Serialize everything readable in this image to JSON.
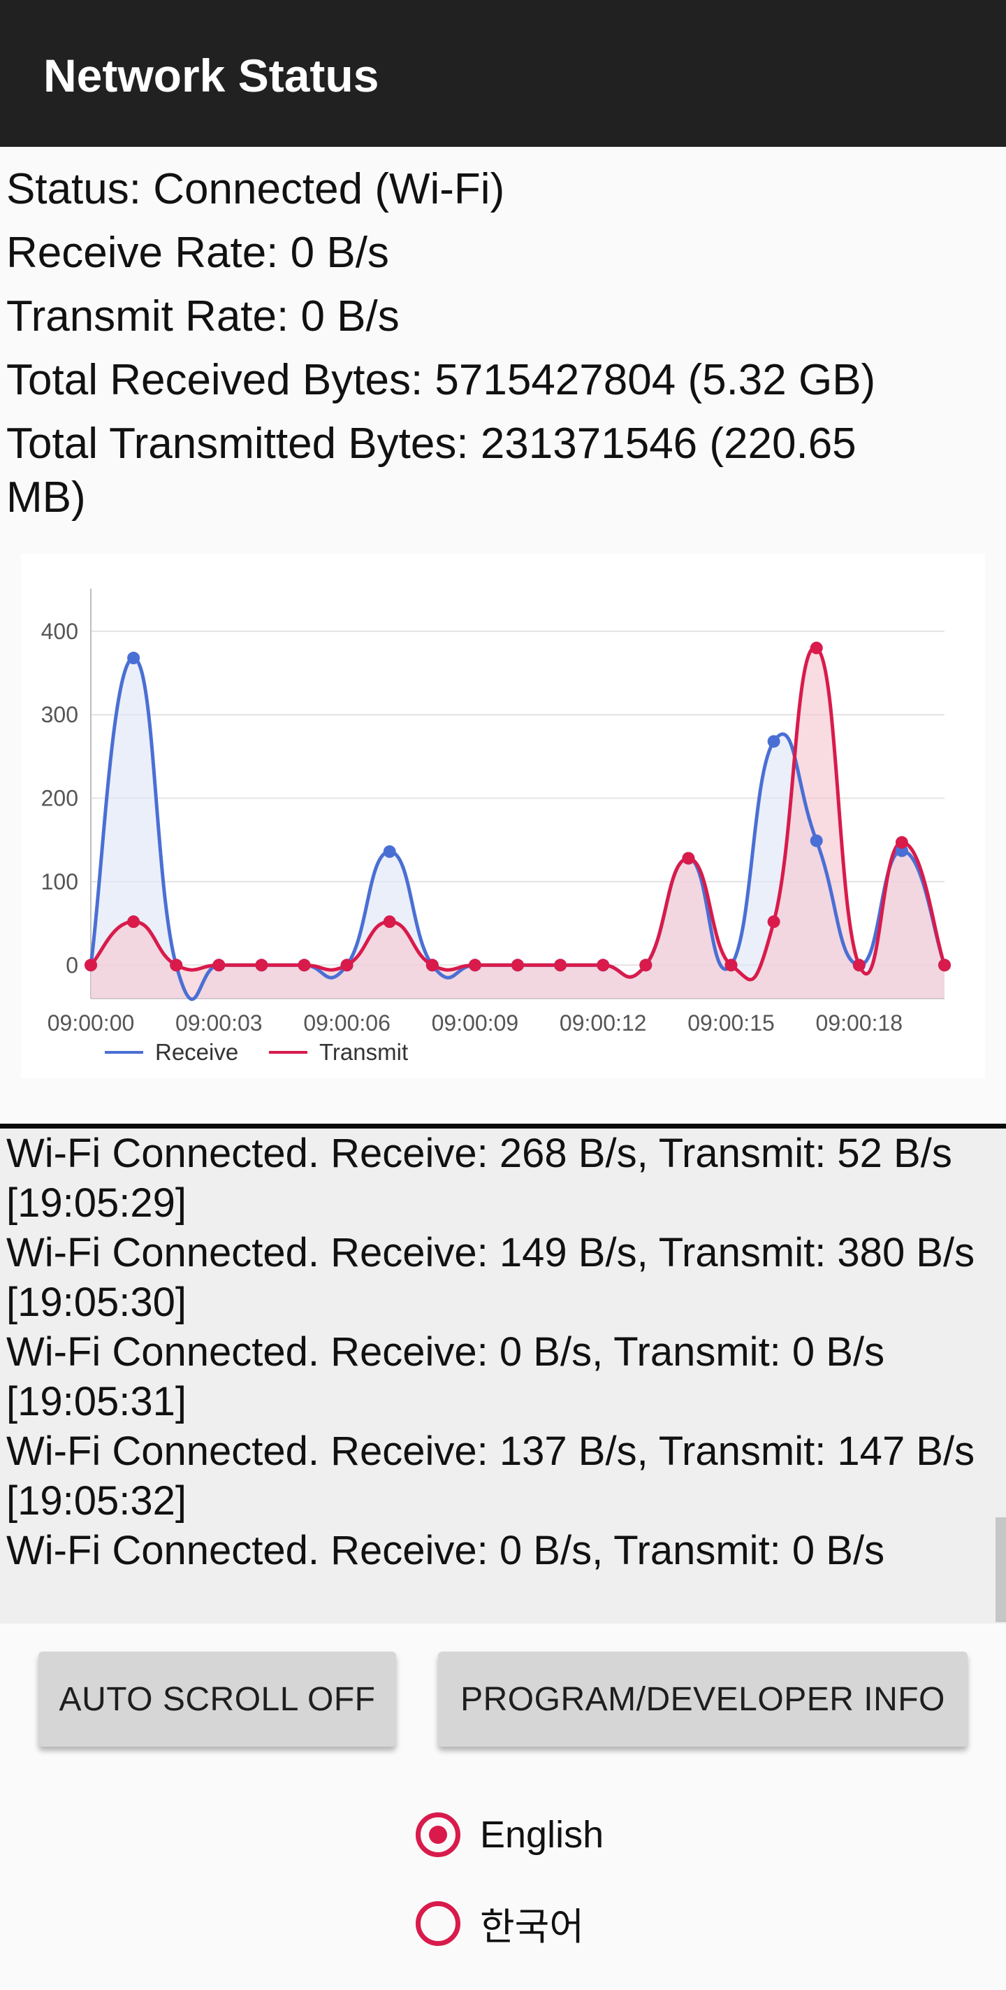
{
  "appbar": {
    "title": "Network Status"
  },
  "stats": {
    "status": "Status: Connected (Wi-Fi)",
    "receive_rate": "Receive Rate: 0 B/s",
    "transmit_rate": "Transmit Rate: 0 B/s",
    "total_received": "Total Received Bytes: 5715427804 (5.32 GB)",
    "total_transmitted_line1": "Total Transmitted Bytes: 231371546 (220.65",
    "total_transmitted_line2": "MB)"
  },
  "chart_data": {
    "type": "area",
    "x": [
      "09:00:00",
      "09:00:01",
      "09:00:02",
      "09:00:03",
      "09:00:04",
      "09:00:05",
      "09:00:06",
      "09:00:07",
      "09:00:08",
      "09:00:09",
      "09:00:10",
      "09:00:11",
      "09:00:12",
      "09:00:13",
      "09:00:14",
      "09:00:15",
      "09:00:16",
      "09:00:17",
      "09:00:18",
      "09:00:19",
      "09:00:20"
    ],
    "x_tick_labels": [
      "09:00:00",
      "09:00:03",
      "09:00:06",
      "09:00:09",
      "09:00:12",
      "09:00:15",
      "09:00:18"
    ],
    "y_tick_labels": [
      "0",
      "100",
      "200",
      "300",
      "400"
    ],
    "ylim": [
      -40,
      430
    ],
    "grid": true,
    "legend_position": "bottom-left",
    "series": [
      {
        "name": "Receive",
        "color": "#4a6fd4",
        "fill": "#dfe6f8",
        "values": [
          0,
          368,
          0,
          0,
          0,
          0,
          0,
          136,
          0,
          0,
          0,
          0,
          0,
          0,
          128,
          0,
          268,
          149,
          0,
          137,
          0
        ]
      },
      {
        "name": "Transmit",
        "color": "#d81b4b",
        "fill": "#f6c7d3",
        "values": [
          0,
          52,
          0,
          0,
          0,
          0,
          0,
          52,
          0,
          0,
          0,
          0,
          0,
          0,
          128,
          0,
          52,
          380,
          0,
          147,
          0
        ]
      }
    ]
  },
  "log": {
    "lines": [
      "Wi-Fi Connected. Receive: 268 B/s, Transmit: 52 B/s",
      "[19:05:29]",
      "Wi-Fi Connected. Receive: 149 B/s, Transmit: 380 B/s",
      "[19:05:30]",
      "Wi-Fi Connected. Receive: 0 B/s, Transmit: 0 B/s",
      "[19:05:31]",
      "Wi-Fi Connected. Receive: 137 B/s, Transmit: 147 B/s",
      "[19:05:32]",
      "Wi-Fi Connected. Receive: 0 B/s, Transmit: 0 B/s"
    ]
  },
  "buttons": {
    "auto_scroll": "AUTO SCROLL OFF",
    "developer_info": "PROGRAM/DEVELOPER INFO"
  },
  "language": {
    "options": [
      {
        "label": "English",
        "selected": true
      },
      {
        "label": "한국어",
        "selected": false
      }
    ]
  },
  "colors": {
    "accent": "#d81b4b",
    "appbar": "#212121",
    "receive": "#4a6fd4",
    "transmit": "#d81b4b"
  }
}
